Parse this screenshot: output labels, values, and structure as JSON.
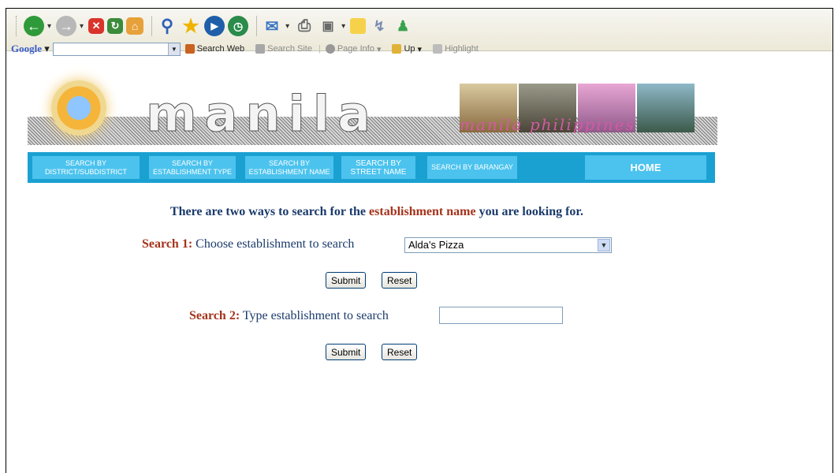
{
  "toolbar": {
    "icons": [
      "back-icon",
      "forward-icon",
      "stop-icon",
      "refresh-icon",
      "home-icon",
      "search-icon",
      "favorites-icon",
      "media-icon",
      "history-icon",
      "mail-icon",
      "print-icon",
      "edit-icon",
      "messenger-icon",
      "bluetooth-icon",
      "msn-icon"
    ]
  },
  "google_bar": {
    "brand": "Google",
    "search_web": "Search Web",
    "search_site": "Search Site",
    "page_info": "Page Info",
    "up": "Up",
    "highlight": "Highlight"
  },
  "site": {
    "logo_text": "manila",
    "photo_caption": "manila philippines"
  },
  "nav": {
    "district": "SEARCH BY DISTRICT/SUBDISTRICT",
    "type": "SEARCH BY ESTABLISHMENT TYPE",
    "name": "SEARCH BY ESTABLISHMENT NAME",
    "street": "SEARCH BY STREET NAME",
    "barangay": "SEARCH BY BARANGAY",
    "home": "HOME"
  },
  "content": {
    "intro_pre": "There are two ways to search for the ",
    "intro_accent": "establishment name",
    "intro_post": " you are looking for.",
    "search1_label": "Search 1:",
    "search1_text": " Choose establishment to search",
    "select_value": "Alda's Pizza",
    "search2_label": "Search 2:",
    "search2_text": " Type establishment to search",
    "submit": "Submit",
    "reset": "Reset"
  },
  "colors": {
    "nav_bar": "#1ba0d2",
    "nav_button": "#4bc3ee",
    "text_blue": "#1a3a6b",
    "text_accent": "#a4331b"
  }
}
